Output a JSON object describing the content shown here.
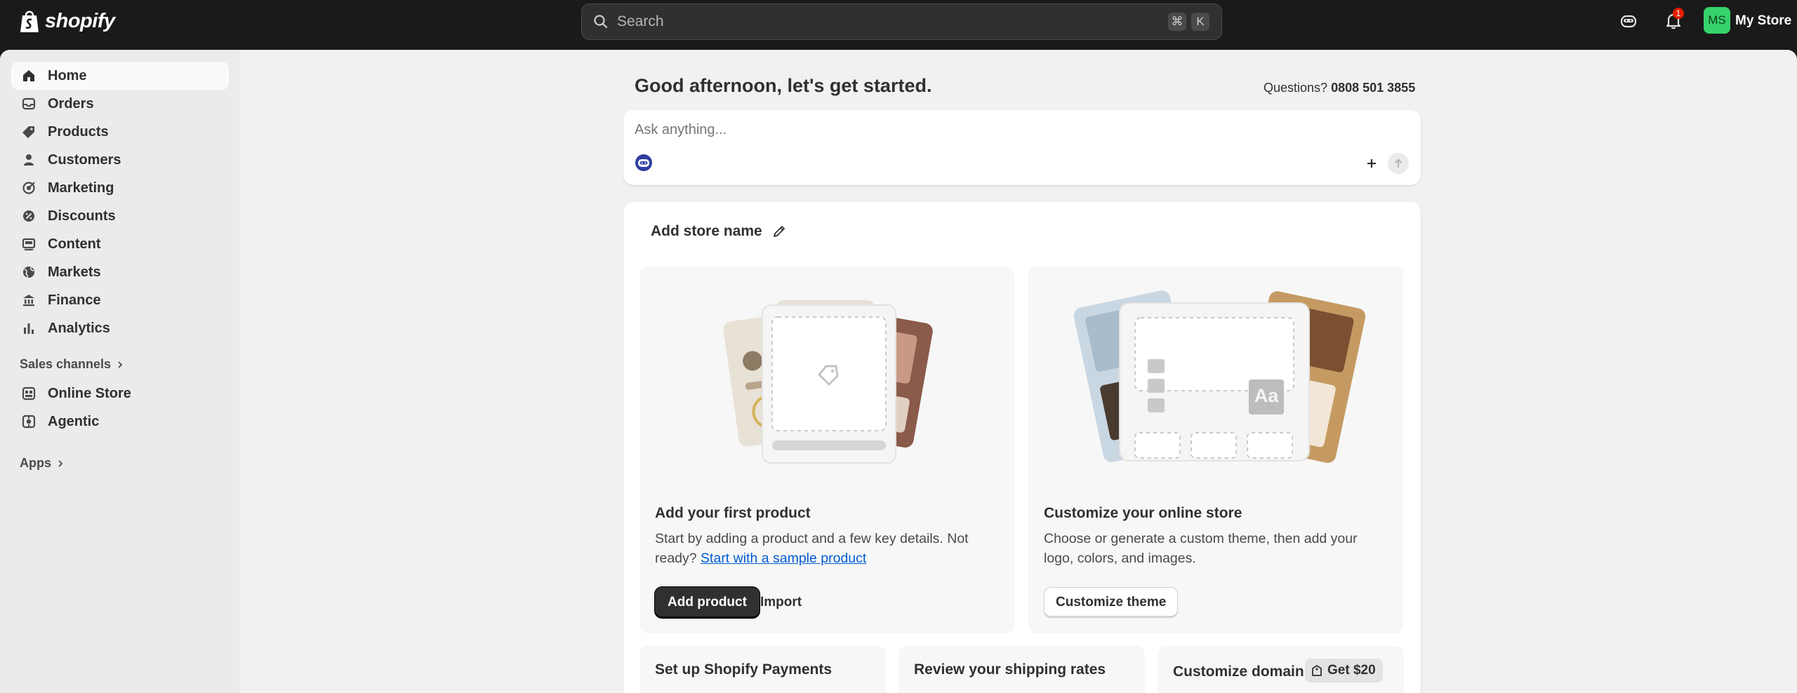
{
  "topbar": {
    "brand": "shopify",
    "search_placeholder": "Search",
    "shortcut_cmd": "⌘",
    "shortcut_key": "K",
    "notification_count": "1",
    "avatar_initials": "MS",
    "store_name": "My Store"
  },
  "sidebar": {
    "items": [
      {
        "label": "Home",
        "icon": "home-icon"
      },
      {
        "label": "Orders",
        "icon": "orders-icon"
      },
      {
        "label": "Products",
        "icon": "tag-icon"
      },
      {
        "label": "Customers",
        "icon": "person-icon"
      },
      {
        "label": "Marketing",
        "icon": "target-icon"
      },
      {
        "label": "Discounts",
        "icon": "discount-icon"
      },
      {
        "label": "Content",
        "icon": "content-icon"
      },
      {
        "label": "Markets",
        "icon": "globe-icon"
      },
      {
        "label": "Finance",
        "icon": "bank-icon"
      },
      {
        "label": "Analytics",
        "icon": "chart-icon"
      }
    ],
    "sales_channels_label": "Sales channels",
    "channels": [
      {
        "label": "Online Store",
        "icon": "store-icon"
      },
      {
        "label": "Agentic",
        "icon": "agentic-icon"
      }
    ],
    "apps_label": "Apps"
  },
  "main": {
    "greeting": "Good afternoon, let's get started.",
    "questions_label": "Questions?",
    "phone": "0808 501 3855",
    "ask_placeholder": "Ask anything...",
    "store_title": "Add store name",
    "tasks": [
      {
        "title": "Add your first product",
        "desc": "Start by adding a product and a few key details. Not ready?",
        "link": "Start with a sample product",
        "primary": "Add product",
        "secondary": "Import"
      },
      {
        "title": "Customize your online store",
        "desc": "Choose or generate a custom theme, then add your logo, colors, and images.",
        "primary": "Customize theme"
      }
    ],
    "illustration_text": "Aa",
    "mini_cards": [
      {
        "title": "Set up Shopify Payments"
      },
      {
        "title": "Review your shipping rates"
      },
      {
        "title": "Customize domain",
        "badge": "Get $20"
      }
    ]
  },
  "colors": {
    "topbar": "#1a1a1a",
    "sidebar": "#ebebeb",
    "background": "#f1f1f1",
    "link": "#005bd3",
    "avatar": "#36d26b",
    "notification": "#e51c00"
  }
}
